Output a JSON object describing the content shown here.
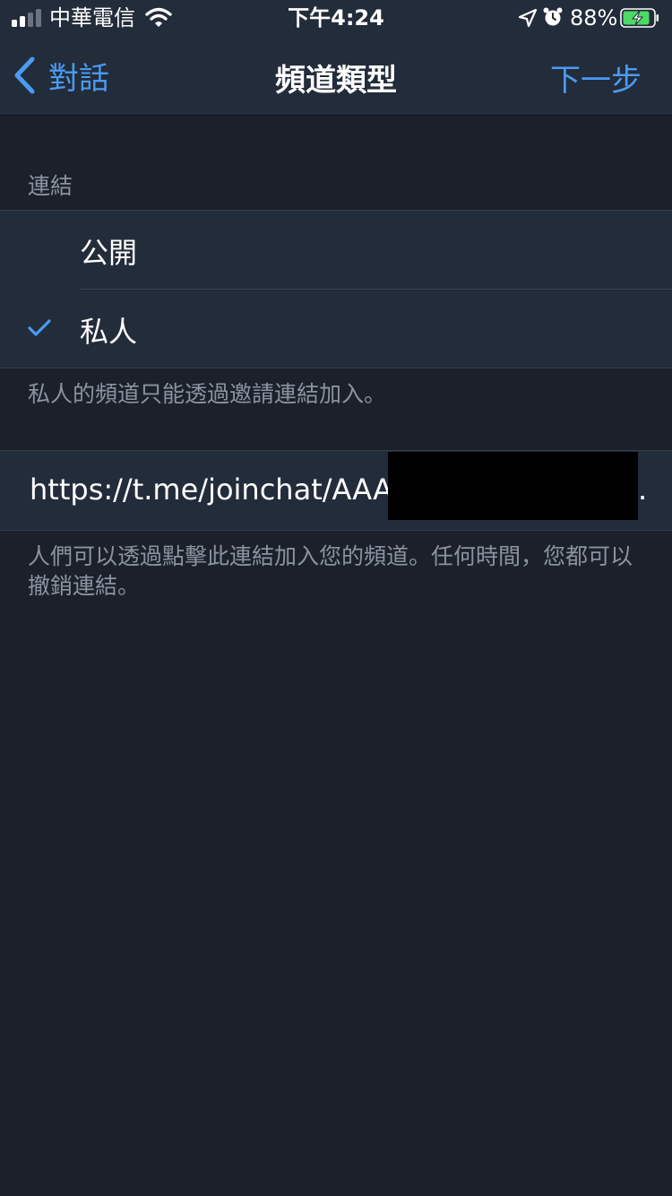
{
  "status_bar": {
    "carrier": "中華電信",
    "time": "下午4:24",
    "battery_percent": "88%",
    "signal_bars": 2,
    "signal_bars_total": 4,
    "battery_level": 0.88,
    "battery_charging": true
  },
  "nav": {
    "back_label": "對話",
    "title": "頻道類型",
    "next_label": "下一步"
  },
  "link_section": {
    "header": "連結",
    "options": [
      {
        "label": "公開",
        "selected": false
      },
      {
        "label": "私人",
        "selected": true
      }
    ],
    "note": "私人的頻道只能透過邀請連結加入。"
  },
  "invite": {
    "url_visible": "https://t.me/joinchat/AAAA",
    "url_tail": ".",
    "note": "人們可以透過點擊此連結加入您的頻道。任何時間，您都可以撤銷連結。"
  },
  "colors": {
    "accent": "#4a9bf2",
    "background": "#1b202a",
    "panel": "#232c3a",
    "secondary_text": "#8a93a0",
    "battery_fill": "#4cd964"
  },
  "icons": {
    "signal": "cellular-signal-icon",
    "wifi": "wifi-icon",
    "location": "location-arrow-icon",
    "alarm": "alarm-clock-icon",
    "battery": "battery-charging-icon",
    "back": "chevron-left-icon",
    "check": "checkmark-icon"
  }
}
